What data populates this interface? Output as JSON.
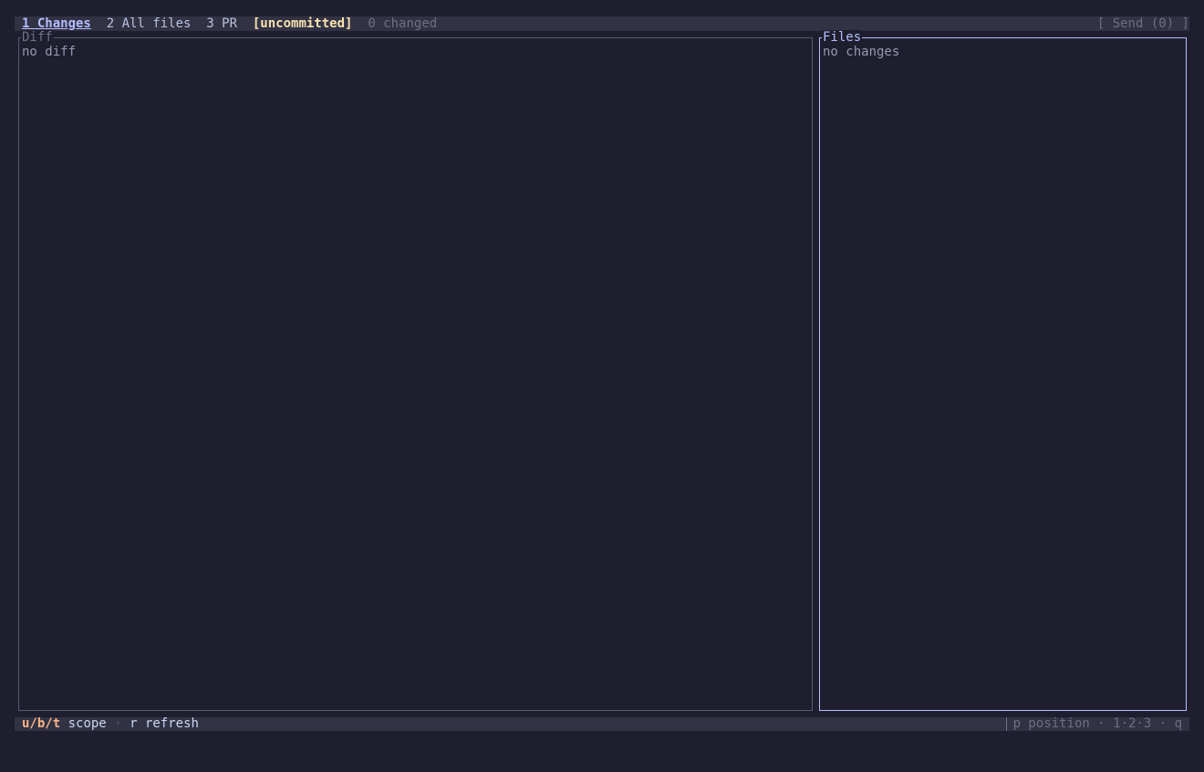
{
  "topbar": {
    "tabs": [
      {
        "label": "1 Changes",
        "active": true
      },
      {
        "label": "2 All files",
        "active": false
      },
      {
        "label": "3 PR",
        "active": false
      }
    ],
    "scope": "[uncommitted]",
    "changed": "0 changed",
    "send": "[ Send (0) ]"
  },
  "diff_panel": {
    "title": "Diff",
    "body": "no diff"
  },
  "files_panel": {
    "title": "Files",
    "body": "no changes"
  },
  "statusbar": {
    "scope_key": "u/b/t",
    "scope_label": "scope",
    "sep1": "·",
    "refresh_key": "r",
    "refresh_label": "refresh",
    "right": "p position · 1·2·3 · q"
  },
  "colors": {
    "background": "#1e1e2e",
    "bar": "#313244",
    "accent": "#b4befe",
    "scope": "#f9e2af",
    "key": "#fab387"
  }
}
